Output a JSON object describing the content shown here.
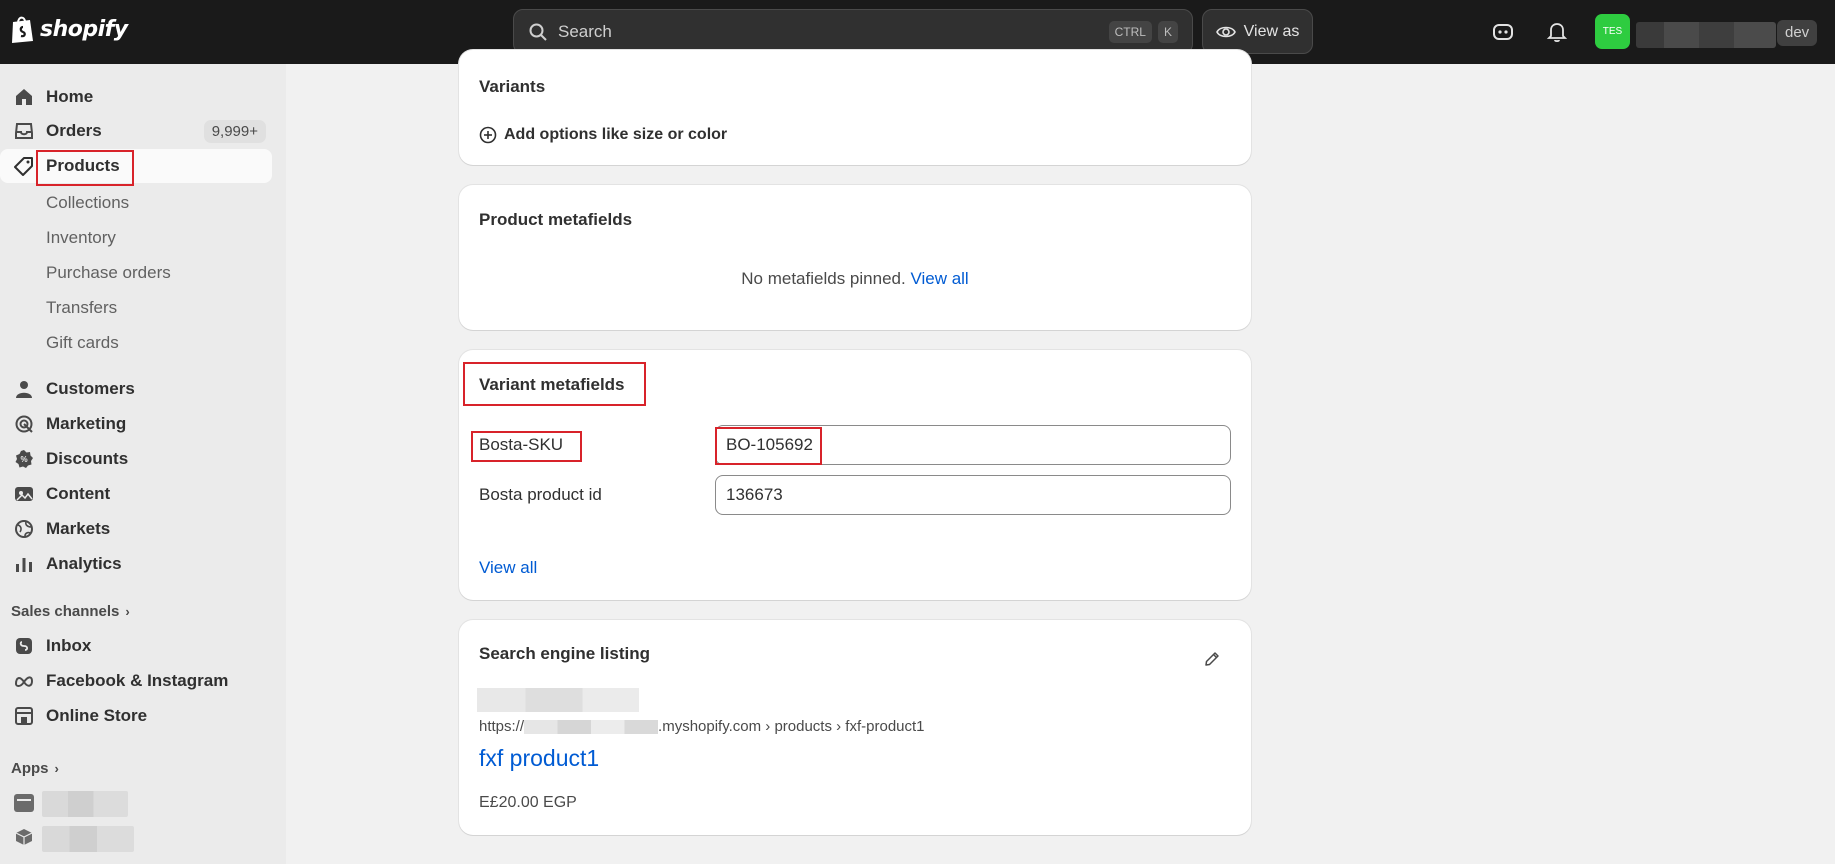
{
  "topbar": {
    "brand": "shopify",
    "search_placeholder": "Search",
    "kbd_ctrl": "CTRL",
    "kbd_k": "K",
    "view_as": "View as",
    "avatar_initials": "TES",
    "store_badge": "dev"
  },
  "sidebar": {
    "home": "Home",
    "orders": "Orders",
    "orders_badge": "9,999+",
    "products": "Products",
    "sub_items": [
      "Collections",
      "Inventory",
      "Purchase orders",
      "Transfers",
      "Gift cards"
    ],
    "customers": "Customers",
    "marketing": "Marketing",
    "discounts": "Discounts",
    "content": "Content",
    "markets": "Markets",
    "analytics": "Analytics",
    "sales_channels": "Sales channels",
    "inbox": "Inbox",
    "facebook_instagram": "Facebook & Instagram",
    "online_store": "Online Store",
    "apps": "Apps"
  },
  "variants_card": {
    "title": "Variants",
    "add_options": "Add options like size or color"
  },
  "product_metafields": {
    "title": "Product metafields",
    "empty_text": "No metafields pinned.",
    "view_all": "View all"
  },
  "variant_metafields": {
    "title": "Variant metafields",
    "fields": [
      {
        "label": "Bosta-SKU",
        "value": "BO-105692"
      },
      {
        "label": "Bosta product id",
        "value": "136673"
      }
    ],
    "view_all": "View all"
  },
  "seo": {
    "title": "Search engine listing",
    "url_prefix": "https://",
    "url_suffix": ".myshopify.com › products › fxf-product1",
    "page_title": "fxf product1",
    "price": "E£20.00 EGP"
  }
}
